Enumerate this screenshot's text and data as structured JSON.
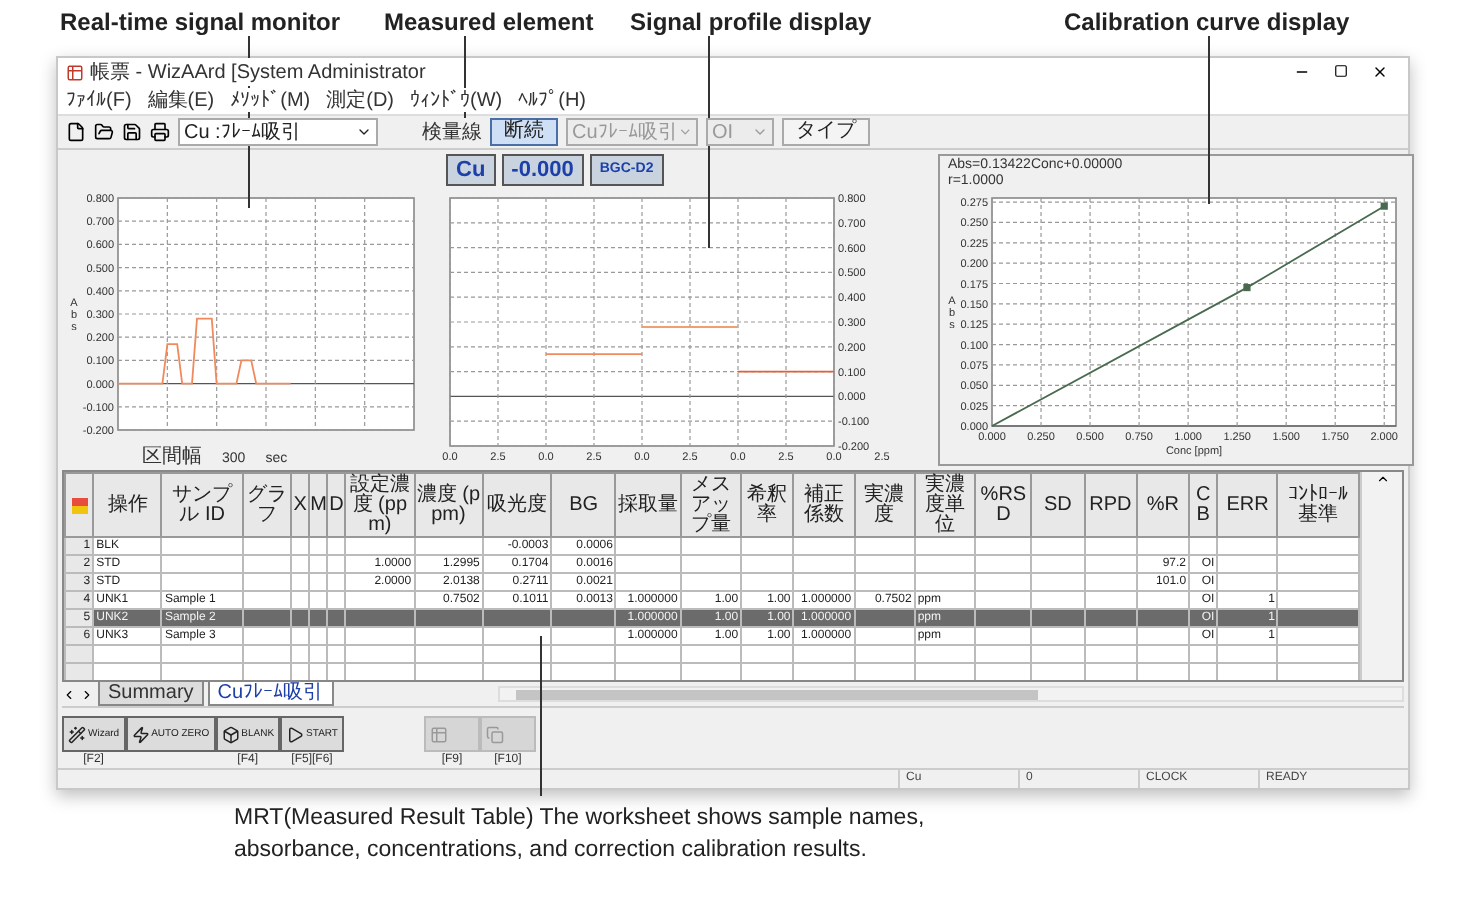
{
  "callouts": {
    "top": [
      "Real-time signal monitor",
      "Measured element",
      "Signal profile display",
      "Calibration curve display"
    ],
    "bottom": "MRT(Measured Result Table) The worksheet shows sample names, absorbance, concentrations, and correction calibration results."
  },
  "window": {
    "title": "帳票 - WizAArd [System Administrator"
  },
  "menu": [
    "ﾌｧｲﾙ(F)",
    "編集(E)",
    "ﾒｿｯﾄﾞ(M)",
    "測定(D)",
    "ｳｨﾝﾄﾞｳ(W)",
    "ﾍﾙﾌﾟ(H)"
  ],
  "toolbar": {
    "method_select": "Cu :ﾌﾚｰﾑ吸引",
    "mode_label": "検量線",
    "mode_button": {
      "label": "断続",
      "selected": true
    },
    "element_select": {
      "value": "Cuﾌﾚｰﾑ吸引",
      "disabled": true
    },
    "cb_select": {
      "value": "OI",
      "disabled": true
    },
    "type_button": "タイプ"
  },
  "measured": {
    "element": "Cu",
    "value": "-0.000",
    "background": "BGC-D2"
  },
  "monitor": {
    "interval_label": "区間幅",
    "interval_value": "300",
    "interval_unit": "sec",
    "chart_data": {
      "type": "line",
      "ylabel": "Abs",
      "grid": true,
      "ylim": [
        -0.2,
        0.8
      ],
      "categories": [
        null,
        null,
        null,
        null,
        null,
        null,
        null,
        null,
        null,
        null,
        null,
        null,
        null,
        null,
        null,
        null,
        null,
        null,
        null,
        null,
        null,
        null,
        null,
        null,
        null,
        null,
        null,
        null,
        null,
        null,
        null,
        null,
        null,
        null,
        null,
        null
      ],
      "yticks": [
        {
          "value": 0.8,
          "label": "0.800"
        },
        {
          "value": 0.7,
          "label": "0.700"
        },
        {
          "value": 0.6,
          "label": "0.600"
        },
        {
          "value": 0.5,
          "label": "0.500"
        },
        {
          "value": 0.4,
          "label": "0.400"
        },
        {
          "value": 0.3,
          "label": "0.300"
        },
        {
          "value": 0.2,
          "label": "0.200"
        },
        {
          "value": 0.1,
          "label": "0.100"
        },
        {
          "value": 0,
          "label": "0.000"
        },
        {
          "value": -0.1,
          "label": "-0.100"
        },
        {
          "value": -0.2,
          "label": "-0.200"
        }
      ],
      "series": [
        {
          "color": "#f08a5d",
          "values": [
            0,
            0,
            0,
            0,
            0,
            0,
            0,
            0,
            0,
            0,
            0.17,
            0.17,
            0.17,
            0,
            0,
            0,
            0.28,
            0.28,
            0.28,
            0.28,
            0,
            0,
            0,
            0,
            0,
            0.1,
            0.1,
            0.1,
            0,
            0,
            0,
            0,
            0,
            0,
            0,
            0
          ]
        }
      ]
    }
  },
  "profile": {
    "chart_data": {
      "type": "line",
      "grid": true,
      "ylim": [
        -0.2,
        0.8
      ],
      "categories": [
        "0.0",
        "2.5",
        "0.0",
        "2.5",
        "0.0",
        "2.5",
        "0.0",
        "2.5",
        "0.0",
        "2.5"
      ],
      "yticks": [
        {
          "value": 0.8,
          "label": "0.800"
        },
        {
          "value": 0.7,
          "label": "0.700"
        },
        {
          "value": 0.6,
          "label": "0.600"
        },
        {
          "value": 0.5,
          "label": "0.500"
        },
        {
          "value": 0.4,
          "label": "0.400"
        },
        {
          "value": 0.3,
          "label": "0.300"
        },
        {
          "value": 0.2,
          "label": "0.200"
        },
        {
          "value": 0.1,
          "label": "0.100"
        },
        {
          "value": 0,
          "label": "0.000"
        },
        {
          "value": -0.1,
          "label": "-0.100"
        },
        {
          "value": -0.2,
          "label": "-0.200"
        }
      ],
      "series": [
        {
          "color": "#f08a5d",
          "values": [
            null,
            null,
            0.17,
            0.17,
            0.17,
            null,
            null,
            null,
            null,
            null
          ]
        },
        {
          "color": "#f0a070",
          "values": [
            null,
            null,
            null,
            null,
            0.28,
            0.28,
            0.28,
            null,
            null,
            null
          ]
        },
        {
          "color": "#e0603a",
          "values": [
            null,
            null,
            null,
            null,
            null,
            null,
            0.1,
            0.1,
            0.1,
            null
          ]
        }
      ]
    }
  },
  "calibration": {
    "equation": "Abs=0.13422Conc+0.00000",
    "r": "r=1.0000",
    "chart_data": {
      "type": "line",
      "xlabel": "Conc [ppm]",
      "ylabel": "Abs",
      "grid": true,
      "xlim": [
        0,
        2.06
      ],
      "ylim": [
        0,
        0.28
      ],
      "xticks": [
        {
          "value": 0,
          "label": "0.000"
        },
        {
          "value": 0.25,
          "label": "0.250"
        },
        {
          "value": 0.5,
          "label": "0.500"
        },
        {
          "value": 0.75,
          "label": "0.750"
        },
        {
          "value": 1,
          "label": "1.000"
        },
        {
          "value": 1.25,
          "label": "1.250"
        },
        {
          "value": 1.5,
          "label": "1.500"
        },
        {
          "value": 1.75,
          "label": "1.750"
        },
        {
          "value": 2,
          "label": "2.000"
        }
      ],
      "yticks": [
        {
          "value": 0,
          "label": "0.000"
        },
        {
          "value": 0.025,
          "label": "0.025"
        },
        {
          "value": 0.05,
          "label": "0.050"
        },
        {
          "value": 0.075,
          "label": "0.075"
        },
        {
          "value": 0.1,
          "label": "0.100"
        },
        {
          "value": 0.125,
          "label": "0.125"
        },
        {
          "value": 0.15,
          "label": "0.150"
        },
        {
          "value": 0.175,
          "label": "0.175"
        },
        {
          "value": 0.2,
          "label": "0.200"
        },
        {
          "value": 0.225,
          "label": "0.225"
        },
        {
          "value": 0.25,
          "label": "0.250"
        },
        {
          "value": 0.275,
          "label": "0.275"
        }
      ],
      "x": [
        0,
        1.3,
        2.0
      ],
      "series": [
        {
          "color": "#4a6a50",
          "values": [
            0,
            0.17,
            0.27
          ]
        }
      ]
    }
  },
  "table": {
    "columns": [
      "操作",
      "サンプル ID",
      "グラフ",
      "X",
      "M",
      "D",
      "設定濃度 (ppm)",
      "濃度 (ppm)",
      "吸光度",
      "BG",
      "採取量",
      "メスアップ量",
      "希釈率",
      "補正係数",
      "実濃度",
      "実濃度単位",
      "%RSD",
      "SD",
      "RPD",
      "%R",
      "CB",
      "ERR",
      "ｺﾝﾄﾛｰﾙ基準"
    ],
    "rows": [
      {
        "number": "1",
        "selected": false,
        "cells": [
          "BLK",
          null,
          null,
          null,
          null,
          null,
          null,
          null,
          "-0.0003",
          "0.0006",
          null,
          null,
          null,
          null,
          null,
          null,
          null,
          null,
          null,
          null,
          null,
          null,
          null
        ]
      },
      {
        "number": "2",
        "selected": false,
        "cells": [
          "STD",
          null,
          null,
          null,
          null,
          null,
          "1.0000",
          "1.2995",
          "0.1704",
          "0.0016",
          null,
          null,
          null,
          null,
          null,
          null,
          null,
          null,
          null,
          "97.2",
          "OI",
          null,
          null
        ]
      },
      {
        "number": "3",
        "selected": false,
        "cells": [
          "STD",
          null,
          null,
          null,
          null,
          null,
          "2.0000",
          "2.0138",
          "0.2711",
          "0.0021",
          null,
          null,
          null,
          null,
          null,
          null,
          null,
          null,
          null,
          "101.0",
          "OI",
          null,
          null
        ]
      },
      {
        "number": "4",
        "selected": false,
        "cells": [
          "UNK1",
          "Sample 1",
          null,
          null,
          null,
          null,
          null,
          "0.7502",
          "0.1011",
          "0.0013",
          "1.000000",
          "1.00",
          "1.00",
          "1.000000",
          "0.7502",
          "ppm",
          null,
          null,
          null,
          null,
          "OI",
          "1",
          null
        ]
      },
      {
        "number": "5",
        "selected": true,
        "cells": [
          "UNK2",
          "Sample 2",
          null,
          null,
          null,
          null,
          null,
          null,
          null,
          null,
          "1.000000",
          "1.00",
          "1.00",
          "1.000000",
          null,
          "ppm",
          null,
          null,
          null,
          null,
          "OI",
          "1",
          null
        ]
      },
      {
        "number": "6",
        "selected": false,
        "cells": [
          "UNK3",
          "Sample 3",
          null,
          null,
          null,
          null,
          null,
          null,
          null,
          null,
          "1.000000",
          "1.00",
          "1.00",
          "1.000000",
          null,
          "ppm",
          null,
          null,
          null,
          null,
          "OI",
          "1",
          null
        ]
      }
    ]
  },
  "sheet_tabs": [
    {
      "label": "Summary",
      "selected": false
    },
    {
      "label": "Cuﾌﾚｰﾑ吸引",
      "selected": true
    }
  ],
  "function_buttons": [
    {
      "label": "Wizard",
      "key": "[F2]",
      "disabled": false
    },
    {
      "label": "AUTO ZERO",
      "disabled": false
    },
    {
      "label": "BLANK",
      "key": "[F4]",
      "disabled": false
    },
    {
      "label": "START",
      "key": "[F5][F6]",
      "disabled": false
    },
    {
      "key": "[F9]",
      "disabled": true
    },
    {
      "key": "[F10]",
      "disabled": true
    }
  ],
  "status_bar": [
    "Cu",
    "0",
    "CLOCK",
    "READY"
  ]
}
